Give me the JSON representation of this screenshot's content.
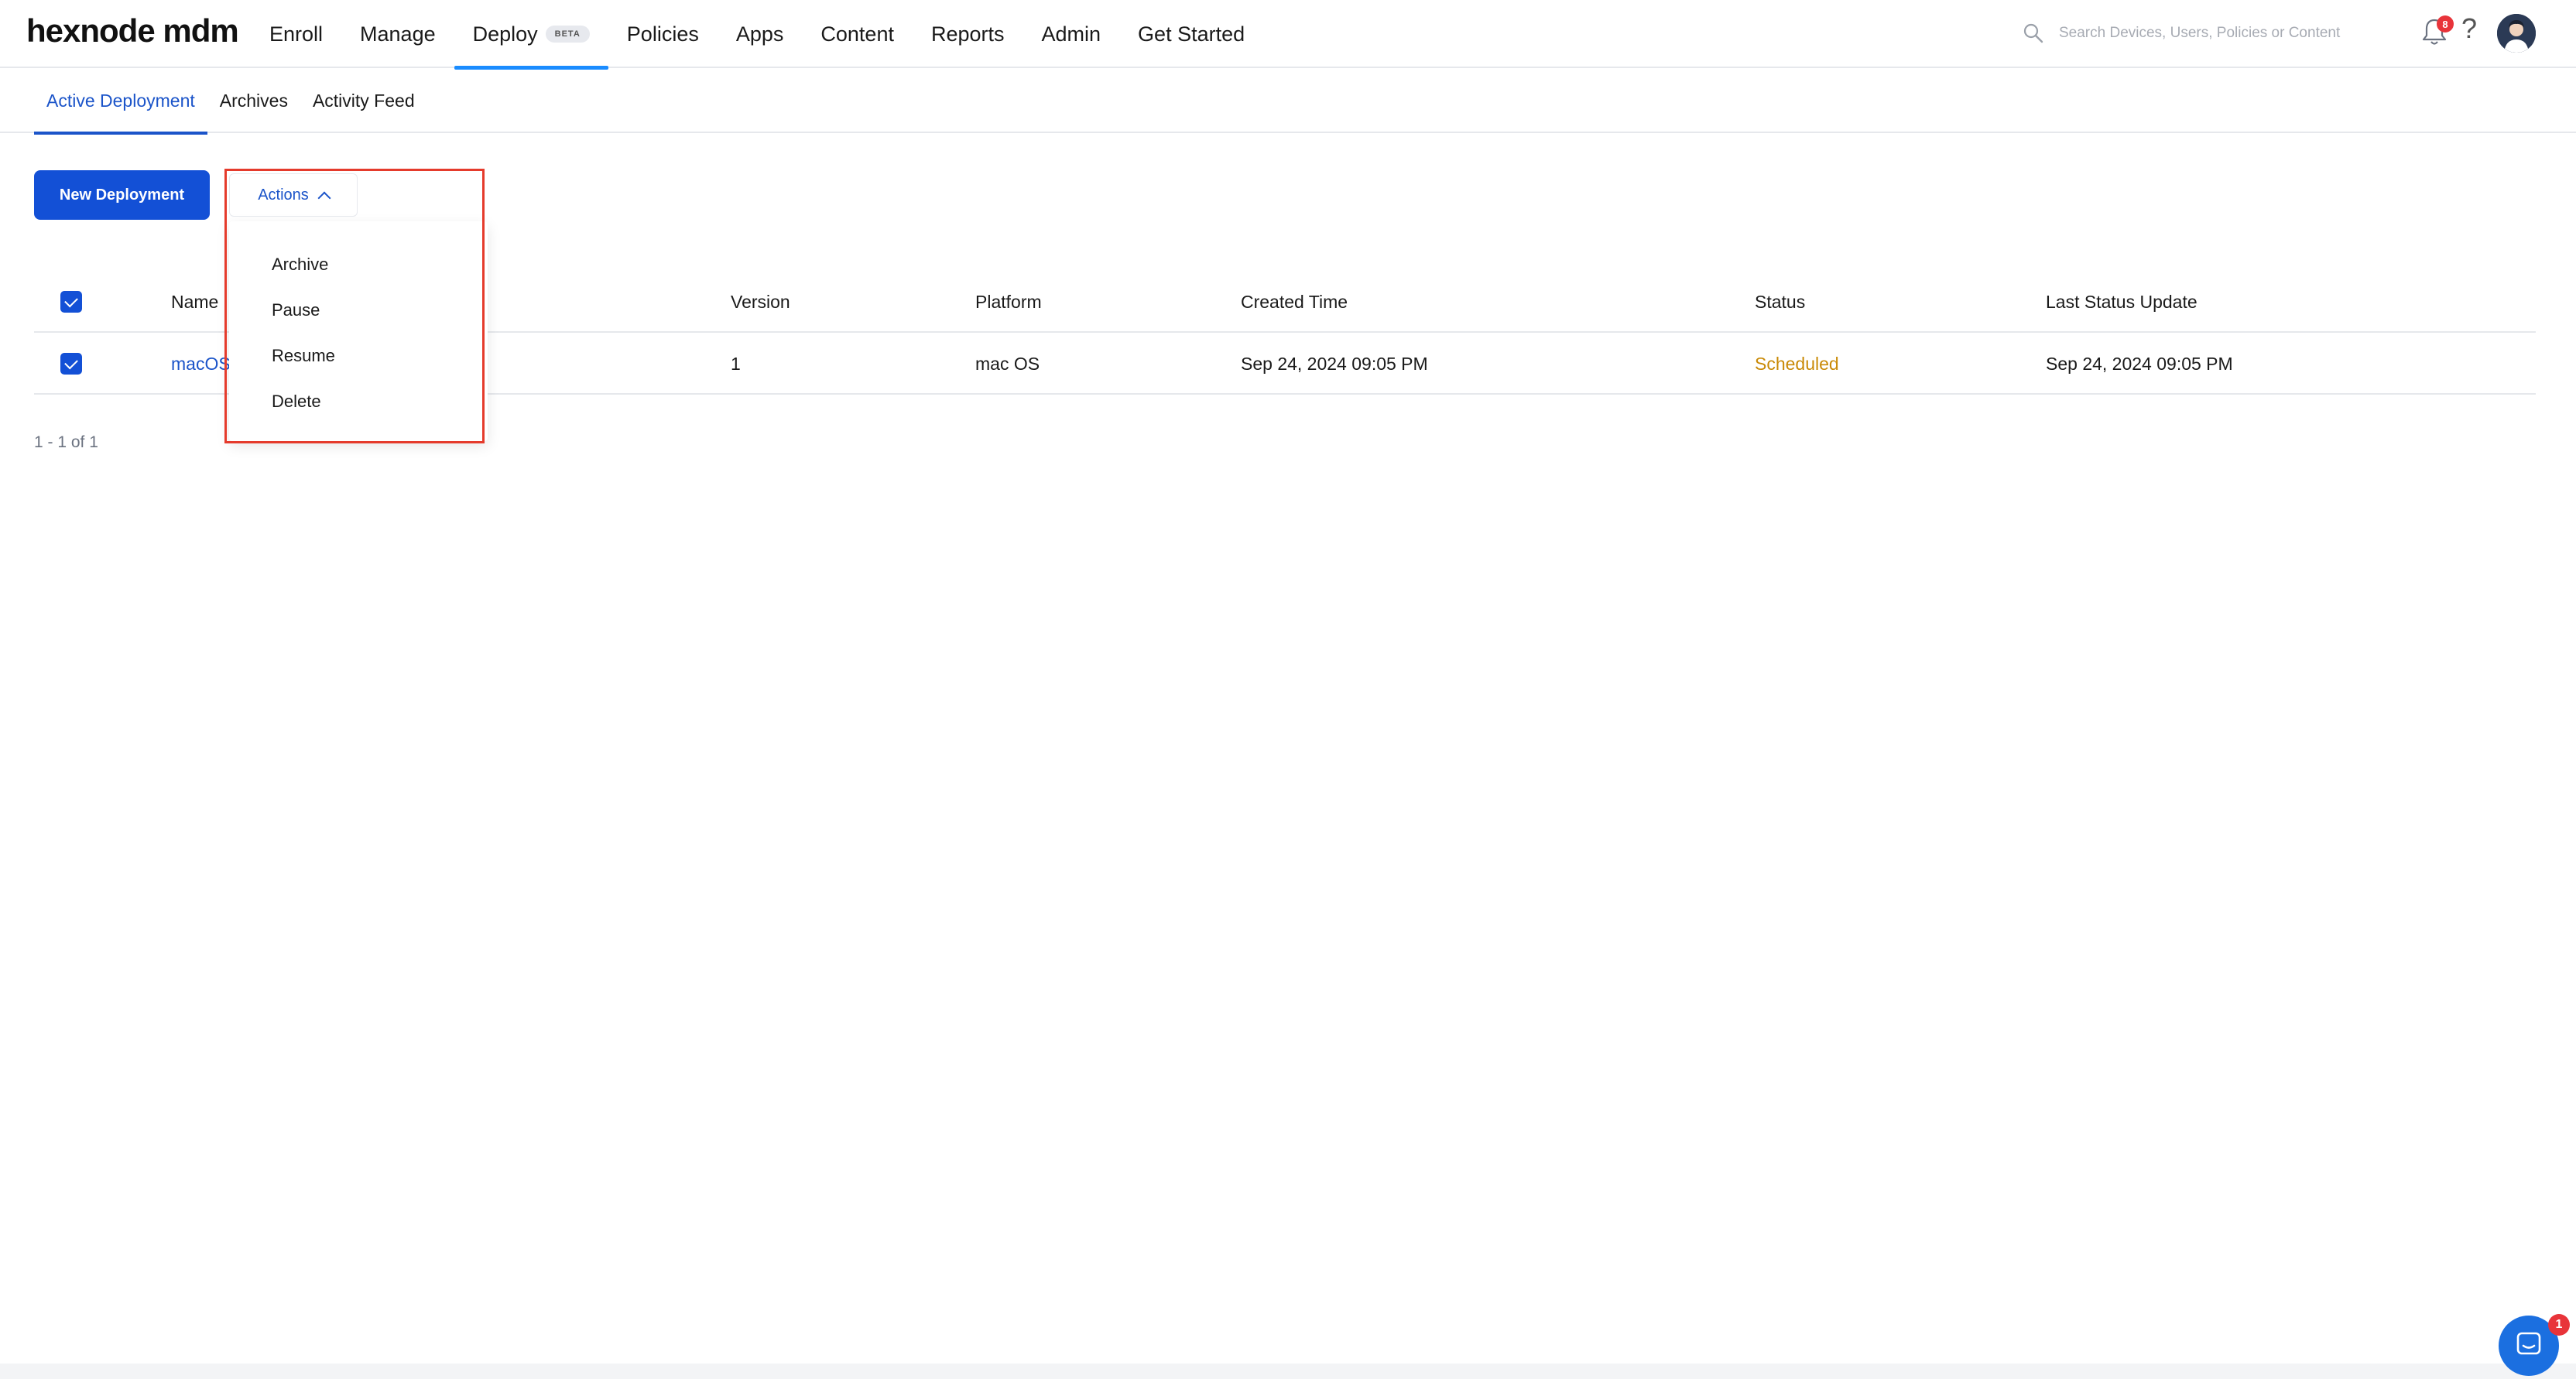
{
  "app": {
    "logo": "hexnode mdm"
  },
  "nav": {
    "items": [
      {
        "label": "Enroll"
      },
      {
        "label": "Manage"
      },
      {
        "label": "Deploy",
        "badge": "BETA",
        "active": true
      },
      {
        "label": "Policies"
      },
      {
        "label": "Apps"
      },
      {
        "label": "Content"
      },
      {
        "label": "Reports"
      },
      {
        "label": "Admin"
      },
      {
        "label": "Get Started"
      }
    ]
  },
  "header": {
    "search_placeholder": "Search Devices, Users, Policies or Content",
    "notification_count": "8",
    "help_icon": "?",
    "icons": [
      "search-icon",
      "bell-icon",
      "help-icon",
      "avatar"
    ]
  },
  "subtabs": [
    {
      "label": "Active Deployment",
      "active": true
    },
    {
      "label": "Archives"
    },
    {
      "label": "Activity Feed"
    }
  ],
  "toolbar": {
    "new_deployment_label": "New Deployment",
    "actions_label": "Actions"
  },
  "actions_menu": {
    "items": [
      "Archive",
      "Pause",
      "Resume",
      "Delete"
    ]
  },
  "table": {
    "columns": [
      "Name",
      "Version",
      "Platform",
      "Created Time",
      "Status",
      "Last Status Update"
    ],
    "rows": [
      {
        "name": "macOS",
        "version": "1",
        "platform": "mac OS",
        "created_time": "Sep 24, 2024 09:05 PM",
        "status": "Scheduled",
        "last_status_update": "Sep 24, 2024 09:05 PM",
        "selected": true
      }
    ]
  },
  "pagination": {
    "text": "1 - 1 of 1"
  },
  "chat": {
    "badge_count": "1"
  },
  "colors": {
    "primary": "#1350d6",
    "link": "#1b54c9",
    "active_nav_underline": "#1a8cff",
    "status_scheduled": "#c98a07",
    "highlight_box": "#e53b2c",
    "badge": "#e8343a"
  }
}
